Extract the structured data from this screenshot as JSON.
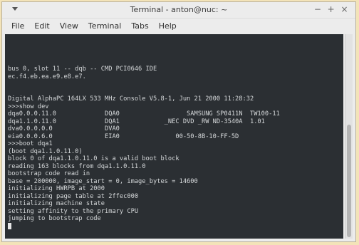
{
  "window": {
    "title": "Terminal - anton@nuc: ~",
    "controls": {
      "minimize": "−",
      "maximize": "+",
      "close": "×"
    }
  },
  "menubar": {
    "items": [
      "File",
      "Edit",
      "View",
      "Terminal",
      "Tabs",
      "Help"
    ]
  },
  "terminal": {
    "lines": [
      "",
      "",
      "",
      "",
      "bus 0, slot 11 -- dqb -- CMD PCI0646 IDE",
      "ec.f4.eb.ea.e9.e8.e7.",
      "",
      "",
      "Digital AlphaPC 164LX 533 MHz Console V5.8-1, Jun 21 2000 11:28:32",
      ">>>show dev",
      "dqa0.0.0.11.0             DQA0                  SAMSUNG SP0411N  TW100-11",
      "dqa1.1.0.11.0             DQA1            _NEC DVD _RW ND-3540A  1.01",
      "dva0.0.0.0.0              DVA0",
      "eia0.0.0.6.0              EIA0               00-50-8B-10-FF-5D",
      ">>>boot dqa1",
      "(boot dqa1.1.0.11.0)",
      "block 0 of dqa1.1.0.11.0 is a valid boot block",
      "reading 163 blocks from dqa1.1.0.11.0",
      "bootstrap code read in",
      "base = 200000, image_start = 0, image_bytes = 14600",
      "initializing HWRPB at 2000",
      "initializing page table at 2ffec000",
      "initializing machine state",
      "setting affinity to the primary CPU",
      "jumping to bootstrap code"
    ]
  },
  "scrollbar": {
    "position_fraction": 1.0,
    "visible_fraction": 0.55
  }
}
